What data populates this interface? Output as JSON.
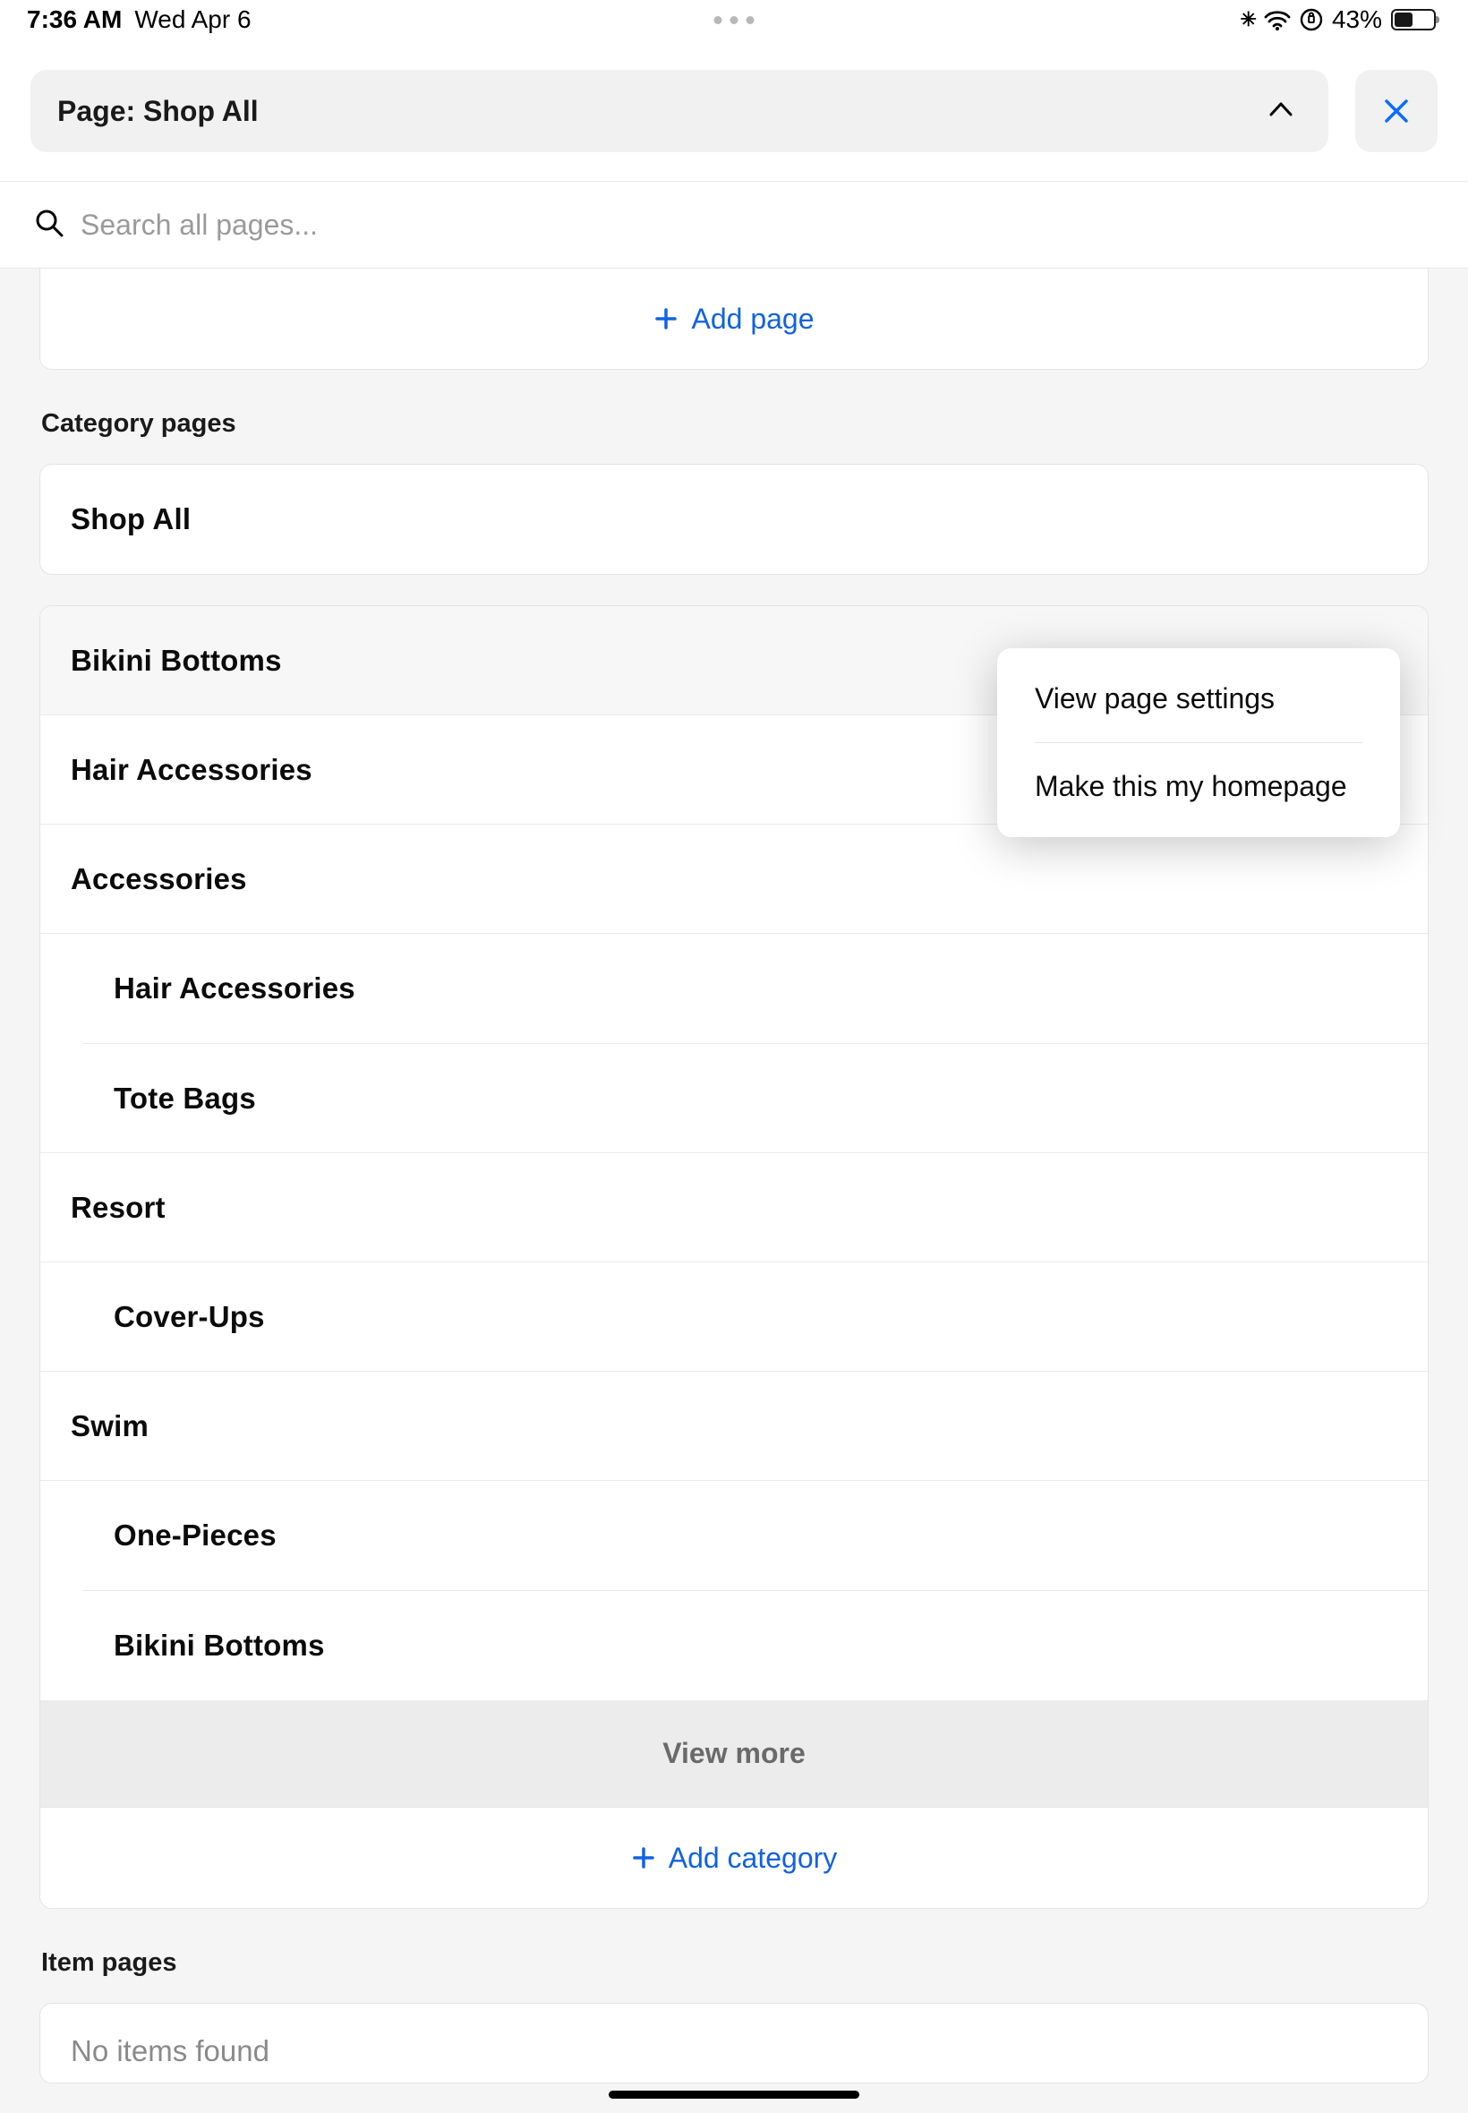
{
  "status": {
    "time": "7:36 AM",
    "date": "Wed Apr 6",
    "battery_percent": "43%"
  },
  "header": {
    "page_label": "Page: Shop All"
  },
  "search": {
    "placeholder": "Search all pages..."
  },
  "add_page_label": "Add page",
  "sections": {
    "category_pages": "Category pages",
    "item_pages": "Item pages"
  },
  "categories": {
    "shop_all": "Shop All",
    "bikini_bottoms": "Bikini Bottoms",
    "hair_accessories": "Hair Accessories",
    "accessories": "Accessories",
    "accessories_children": {
      "hair_accessories": "Hair Accessories",
      "tote_bags": "Tote Bags"
    },
    "resort": "Resort",
    "resort_children": {
      "cover_ups": "Cover-Ups"
    },
    "swim": "Swim",
    "swim_children": {
      "one_pieces": "One-Pieces",
      "bikini_bottoms": "Bikini Bottoms"
    }
  },
  "view_more_label": "View more",
  "add_category_label": "Add category",
  "popover": {
    "view_settings": "View page settings",
    "make_homepage": "Make this my homepage"
  },
  "no_items_label": "No items found"
}
